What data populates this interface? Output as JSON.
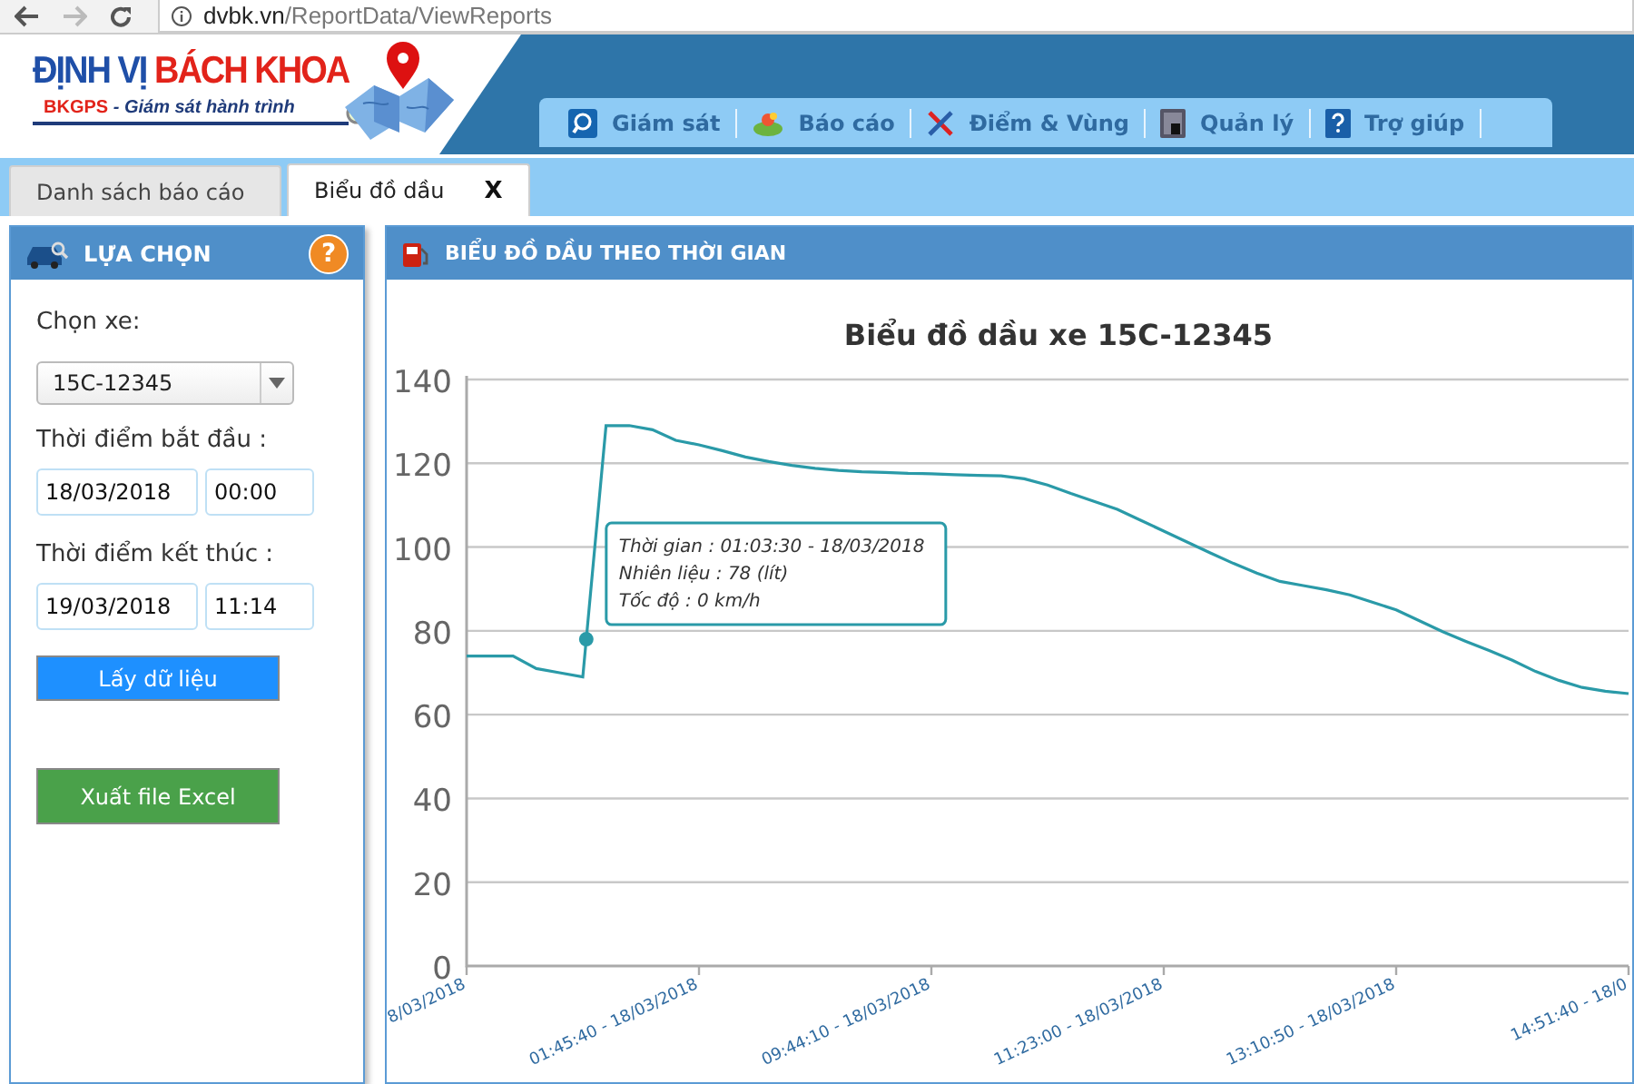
{
  "browser": {
    "url_host": "dvbk.vn",
    "url_path": "/ReportData/ViewReports"
  },
  "logo": {
    "title_part1": "ĐỊNH VỊ",
    "title_part2": "BÁCH KHOA",
    "tagline_brand": "BKGPS",
    "tagline": "- Giám sát hành trình"
  },
  "nav": [
    {
      "label": "Giám sát",
      "kind": "monitor"
    },
    {
      "label": "Báo cáo",
      "kind": "report"
    },
    {
      "label": "Điểm & Vùng",
      "kind": "tools"
    },
    {
      "label": "Quản lý",
      "kind": "manage"
    },
    {
      "label": "Trợ giúp",
      "kind": "help"
    }
  ],
  "tabs": [
    {
      "label": "Danh sách báo cáo",
      "selected": false
    },
    {
      "label": "Biểu đồ dầu",
      "selected": true,
      "close": "X"
    }
  ],
  "options_panel": {
    "title": "LỰA CHỌN",
    "help": "?",
    "vehicle_label": "Chọn xe:",
    "vehicle": "15C-12345",
    "start_label": "Thời điểm bắt đầu :",
    "start_date": "18/03/2018",
    "start_time": "00:00",
    "end_label": "Thời điểm kết thúc :",
    "end_date": "19/03/2018",
    "end_time": "11:14",
    "buttons": [
      {
        "label": "Lấy dữ liệu",
        "kind": "primary"
      },
      {
        "label": "Xuất file Excel",
        "kind": "export"
      }
    ]
  },
  "chart_panel": {
    "title": "BIỂU ĐỒ DẦU THEO THỜI GIAN",
    "chart_data": {
      "type": "line",
      "title": "Biểu đồ dầu xe 15C-12345",
      "categories": [
        "8/03/2018",
        null,
        null,
        null,
        null,
        null,
        null,
        null,
        null,
        null,
        "01:45:40 - 18/03/2018",
        null,
        null,
        null,
        null,
        null,
        null,
        null,
        null,
        null,
        "09:44:10 - 18/03/2018",
        null,
        null,
        null,
        null,
        null,
        null,
        null,
        null,
        null,
        "11:23:00 - 18/03/2018",
        null,
        null,
        null,
        null,
        null,
        null,
        null,
        null,
        null,
        "13:10:50 - 18/03/2018",
        null,
        null,
        null,
        null,
        null,
        null,
        null,
        null,
        null,
        "14:51:40 - 18/0"
      ],
      "grid": true,
      "series": [
        {
          "color": "#2a9aa8",
          "values": [
            74,
            74,
            74,
            71,
            70,
            69,
            129,
            129,
            128,
            125.5,
            124.4,
            123,
            121.5,
            120.4,
            119.5,
            118.8,
            118.3,
            118,
            117.8,
            117.6,
            117.5,
            117.3,
            117.1,
            117,
            116.3,
            114.8,
            112.8,
            110.9,
            109,
            106.4,
            103.8,
            101.2,
            98.6,
            96.1,
            93.8,
            91.8,
            90.8,
            89.8,
            88.6,
            86.8,
            85,
            82.4,
            79.8,
            77.5,
            75.3,
            73,
            70.3,
            68.2,
            66.5,
            65.6,
            65
          ]
        }
      ],
      "ylim": [
        0,
        140
      ],
      "yticks": [
        0,
        20,
        40,
        60,
        80,
        100,
        120,
        140
      ],
      "annotations": [
        "Thời gian : 01:03:30 - 18/03/2018\nNhiên liệu : 78 (lít)\nTốc độ : 0 km/h"
      ]
    }
  }
}
